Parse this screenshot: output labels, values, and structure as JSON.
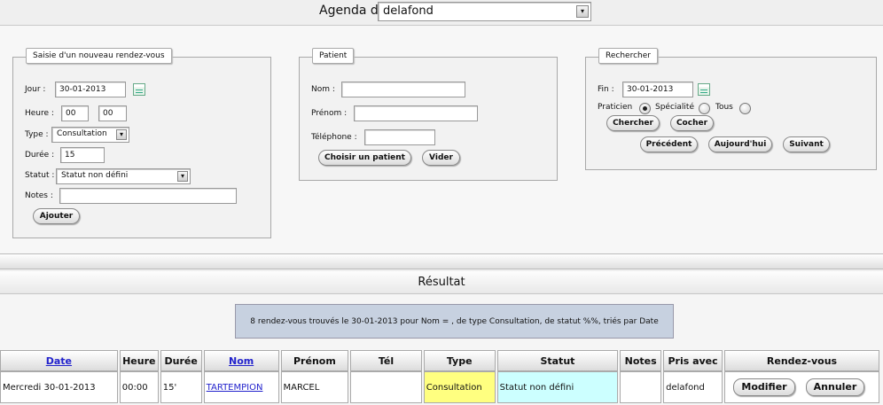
{
  "header": {
    "label": "Agenda de",
    "selected": "delafond"
  },
  "new_appointment": {
    "legend": "Saisie d'un nouveau rendez-vous",
    "jour_label": "Jour :",
    "jour_value": "30-01-2013",
    "heure_label": "Heure :",
    "heure_h": "00",
    "heure_m": "00",
    "type_label": "Type :",
    "type_value": "Consultation",
    "duree_label": "Durée :",
    "duree_value": "15",
    "statut_label": "Statut :",
    "statut_value": "Statut non défini",
    "notes_label": "Notes :",
    "notes_value": "",
    "add_button": "Ajouter"
  },
  "patient": {
    "legend": "Patient",
    "nom_label": "Nom :",
    "prenom_label": "Prénom :",
    "tel_label": "Téléphone :",
    "choose_button": "Choisir un patient",
    "clear_button": "Vider"
  },
  "search": {
    "legend": "Rechercher",
    "fin_label": "Fin :",
    "fin_value": "30-01-2013",
    "praticien_label": "Praticien",
    "specialite_label": "Spécialité",
    "tous_label": "Tous",
    "chercher_button": "Chercher",
    "cocher_button": "Cocher",
    "prev_button": "Précédent",
    "today_button": "Aujourd'hui",
    "next_button": "Suivant"
  },
  "result": {
    "title": "Résultat",
    "message": "8 rendez-vous trouvés le 30-01-2013 pour Nom = , de type Consultation, de statut %%, triés par Date",
    "columns": [
      "Date",
      "Heure",
      "Durée",
      "Nom",
      "Prénom",
      "Tél",
      "Type",
      "Statut",
      "Notes",
      "Pris avec",
      "Rendez-vous"
    ],
    "rows": [
      {
        "date": "Mercredi 30-01-2013",
        "heure": "00:00",
        "duree": "15'",
        "nom": "TARTEMPION",
        "prenom": "MARCEL",
        "tel": "",
        "type": "Consultation",
        "statut": "Statut non défini",
        "notes": "",
        "pris_avec": "delafond",
        "modify": "Modifier",
        "cancel": "Annuler"
      }
    ]
  },
  "colors": {
    "type_cell": "#ffff80",
    "statut_cell": "#ccffff",
    "message_bg": "#c7d1e0"
  }
}
